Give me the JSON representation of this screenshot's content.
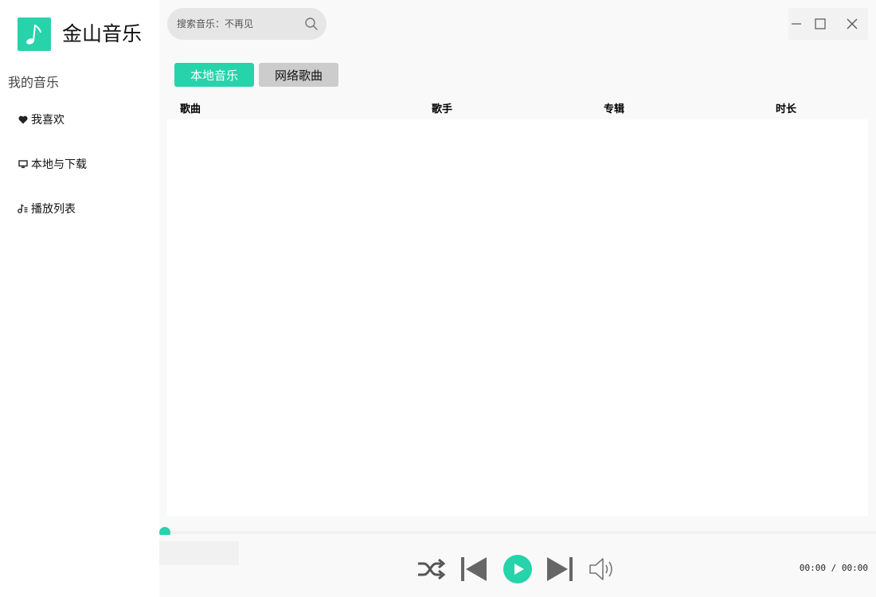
{
  "app": {
    "title": "金山音乐",
    "accent": "#26d3ab",
    "logo_icon": "music-note-icon"
  },
  "sidebar": {
    "section_label": "我的音乐",
    "items": [
      {
        "label": "我喜欢",
        "icon": "heart-icon"
      },
      {
        "label": "本地与下载",
        "icon": "monitor-icon"
      },
      {
        "label": "播放列表",
        "icon": "playlist-icon"
      }
    ]
  },
  "search": {
    "placeholder": "搜索音乐：不再见",
    "icon": "search-icon"
  },
  "tabs": [
    {
      "label": "本地音乐",
      "active": true
    },
    {
      "label": "网络歌曲",
      "active": false
    }
  ],
  "table": {
    "columns": [
      "歌曲",
      "歌手",
      "专辑",
      "时长"
    ],
    "rows": []
  },
  "player": {
    "progress": 0,
    "time": "00:00 / 00:00",
    "icons": [
      "shuffle-icon",
      "previous-icon",
      "play-icon",
      "next-icon",
      "volume-icon"
    ]
  }
}
